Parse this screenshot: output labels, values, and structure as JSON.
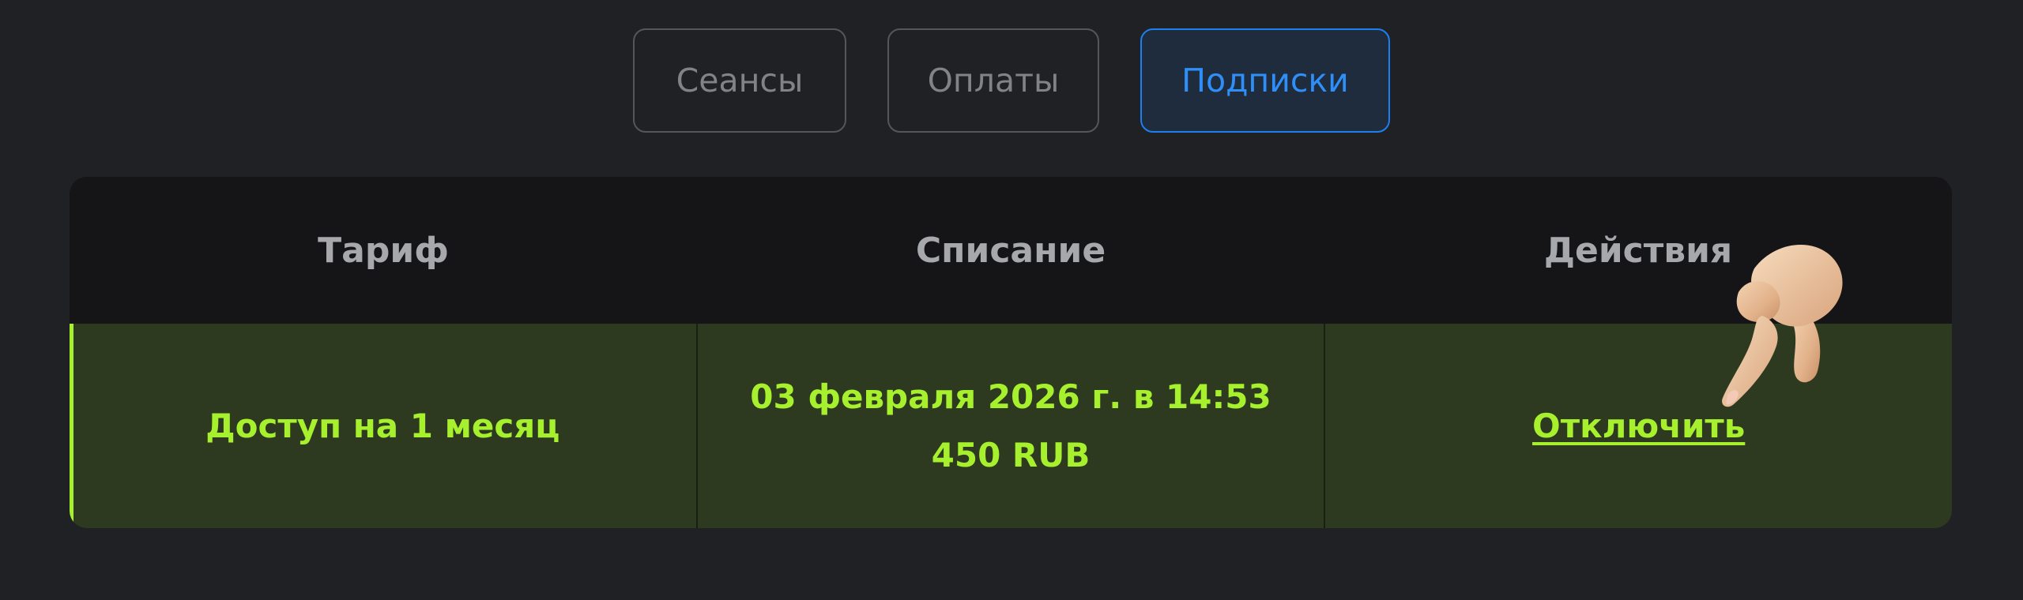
{
  "tabs": [
    {
      "label": "Сеансы",
      "active": false
    },
    {
      "label": "Оплаты",
      "active": false
    },
    {
      "label": "Подписки",
      "active": true
    }
  ],
  "table": {
    "headers": [
      "Тариф",
      "Списание",
      "Действия"
    ],
    "rows": [
      {
        "tariff": "Доступ на 1 месяц",
        "charge_date": "03 февраля 2026 г. в 14:53",
        "charge_amount": "450 RUB",
        "action": "Отключить"
      }
    ]
  },
  "colors": {
    "background": "#202125",
    "accent_active_tab": "#2f8ff8",
    "row_highlight": "#a6f02e",
    "row_background": "#2d3a20"
  },
  "icons": {
    "pointer": "pointing-hand-icon"
  }
}
